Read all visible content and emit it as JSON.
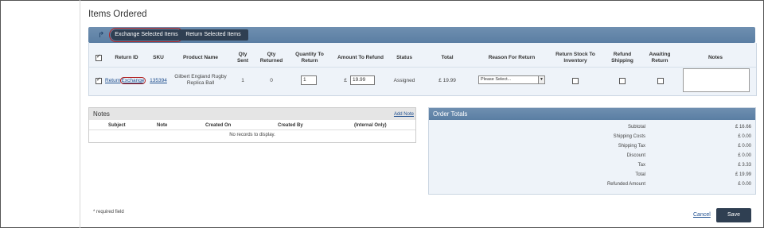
{
  "page": {
    "title": "Items Ordered"
  },
  "toolbar": {
    "exchange_label": "Exchange Selected Items",
    "return_label": "Return Selected Items",
    "accent": "#5a7ea3"
  },
  "items_table": {
    "headers": {
      "return_id": "Return ID",
      "sku": "SKU",
      "product_name": "Product Name",
      "qty_sent": "Qty\nSent",
      "qty_returned": "Qty\nReturned",
      "quantity_to_return": "Quantity To\nReturn",
      "amount_to_refund": "Amount To Refund",
      "status": "Status",
      "total": "Total",
      "reason_for_return": "Reason For Return",
      "return_stock": "Return Stock To\nInventory",
      "refund_shipping": "Refund\nShipping",
      "awaiting_return": "Awaiting\nReturn",
      "notes": "Notes"
    },
    "row": {
      "return_link": "Return",
      "exchange_link": "Exchange",
      "sku": "135394",
      "product_name": "Gilbert England Rugby\nReplica Ball",
      "qty_sent": "1",
      "qty_returned": "0",
      "quantity_to_return": "1",
      "currency": "£",
      "amount_to_refund": "19.99",
      "status": "Assigned",
      "total": "£ 19.99",
      "reason_placeholder": "Please Select..."
    }
  },
  "notes": {
    "title": "Notes",
    "add_note": "Add Note",
    "headers": [
      "Subject",
      "Note",
      "Created On",
      "Created By",
      "(Internal Only)"
    ],
    "empty": "No records to display."
  },
  "totals": {
    "title": "Order Totals",
    "rows": [
      {
        "label": "Subtotal",
        "value": "£ 16.66"
      },
      {
        "label": "Shipping Costs",
        "value": "£ 0.00"
      },
      {
        "label": "Shipping Tax",
        "value": "£ 0.00"
      },
      {
        "label": "Discount",
        "value": "£ 0.00"
      },
      {
        "label": "Tax",
        "value": "£ 3.33"
      },
      {
        "label": "Total",
        "value": "£ 19.99"
      },
      {
        "label": "Refunded Amount",
        "value": "£ 0.00"
      }
    ]
  },
  "footer": {
    "required_note": "* required field",
    "cancel_label": "Cancel",
    "save_label": "Save"
  }
}
